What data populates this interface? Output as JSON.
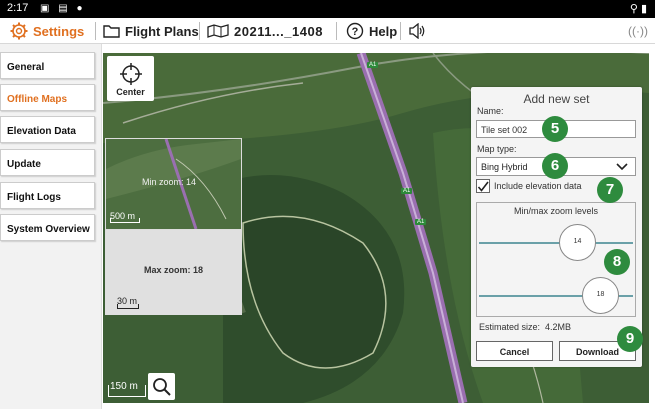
{
  "status_bar": {
    "time": "2:17"
  },
  "toolbar": {
    "settings_label": "Settings",
    "flight_plans_label": "Flight Plans",
    "file_label": "20211..._1408",
    "help_label": "Help"
  },
  "sidebar": {
    "items": [
      {
        "label": "General"
      },
      {
        "label": "Offline Maps"
      },
      {
        "label": "Elevation Data"
      },
      {
        "label": "Update"
      },
      {
        "label": "Flight Logs"
      },
      {
        "label": "System Overview"
      }
    ],
    "active": "Offline Maps"
  },
  "map": {
    "center_label": "Center",
    "min_zoom_label": "Min zoom: 14",
    "min_zoom_scale": "500 m",
    "max_zoom_label": "Max zoom: 18",
    "max_zoom_scale": "30 m",
    "map_scale": "150 m",
    "road_labels": [
      "A1",
      "A1",
      "A1"
    ]
  },
  "panel": {
    "title": "Add new set",
    "name_label": "Name:",
    "name_value": "Tile set 002",
    "map_type_label": "Map type:",
    "map_type_value": "Bing Hybrid",
    "include_elevation_label": "Include elevation data",
    "include_elevation_checked": true,
    "zoom_levels_label": "Min/max zoom levels",
    "min_zoom_value": "14",
    "max_zoom_value": "18",
    "estimated_size_label": "Estimated size:",
    "estimated_size_value": "4.2MB",
    "cancel_label": "Cancel",
    "download_label": "Download"
  },
  "badges": [
    "5",
    "6",
    "7",
    "8",
    "9"
  ],
  "colors": {
    "accent": "#e07020",
    "badge": "#2e8b3e",
    "slider": "#6aa0a8"
  }
}
